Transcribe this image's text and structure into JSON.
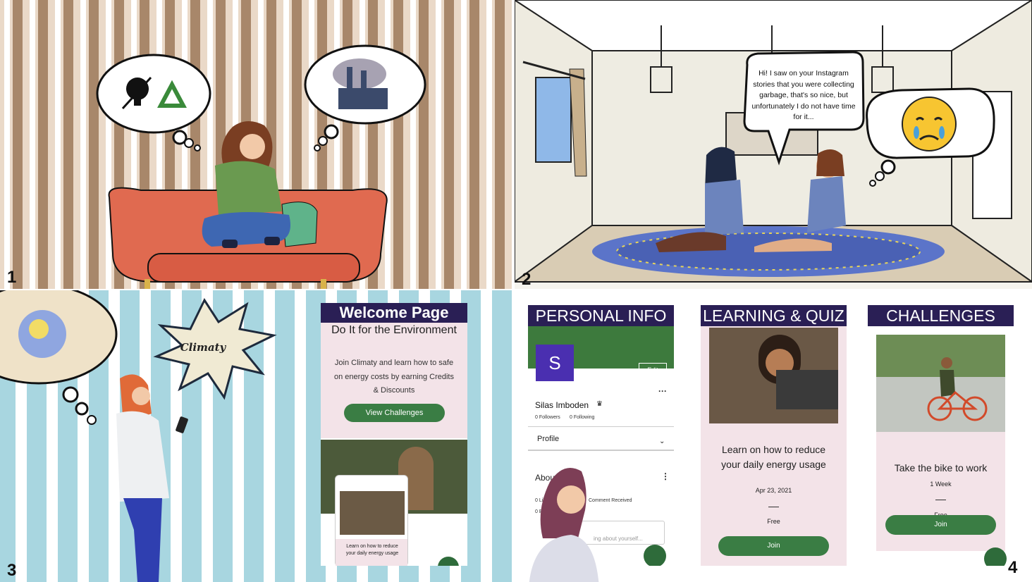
{
  "panels": {
    "p1": {
      "number": "1"
    },
    "p2": {
      "number": "2",
      "speech": "Hi! I saw on your Instagram stories that you were collecting garbage, that's so nice, but unfortunately I do not have time for it..."
    },
    "p3": {
      "number": "3",
      "logo": "Climaty",
      "welcome": {
        "title": "Welcome Page",
        "subtitle": "Do It for the Environment",
        "body": "Join Climaty and learn how to safe on energy costs by earning Credits & Discounts",
        "button": "View Challenges",
        "mini_text": "Learn on how to reduce your daily energy usage"
      }
    },
    "p4": {
      "number": "4",
      "personal": {
        "header": "PERSONAL INFO",
        "avatar_letter": "S",
        "edit": "Edit",
        "name": "Silas Imboden",
        "followers": "0 Followers",
        "following": "0 Following",
        "profile": "Profile",
        "about": "About",
        "likes": "0 Lik",
        "comments": "Comment Received",
        "b_line": "0 B",
        "placeholder": "ing about yourself..."
      },
      "learning": {
        "header": "LEARNING & QUIZ",
        "text": "Learn on how to reduce your daily energy usage",
        "date": "Apr 23, 2021",
        "price": "Free",
        "button": "Join"
      },
      "challenges": {
        "header": "CHALLENGES",
        "text": "Take the bike to work",
        "duration": "1 Week",
        "price": "Free",
        "button": "Join"
      }
    }
  },
  "colors": {
    "header": "#2a1f55",
    "button": "#3a7d44",
    "card_pink": "#f3e3e8",
    "sofa": "#e06a50",
    "rug": "#5b74c9"
  },
  "icons": [
    "light-bulb-off-icon",
    "recycle-icon",
    "factory-icon",
    "crying-face-icon",
    "crown-icon",
    "chevron-down-icon",
    "more-dots-icon",
    "chat-icon"
  ]
}
